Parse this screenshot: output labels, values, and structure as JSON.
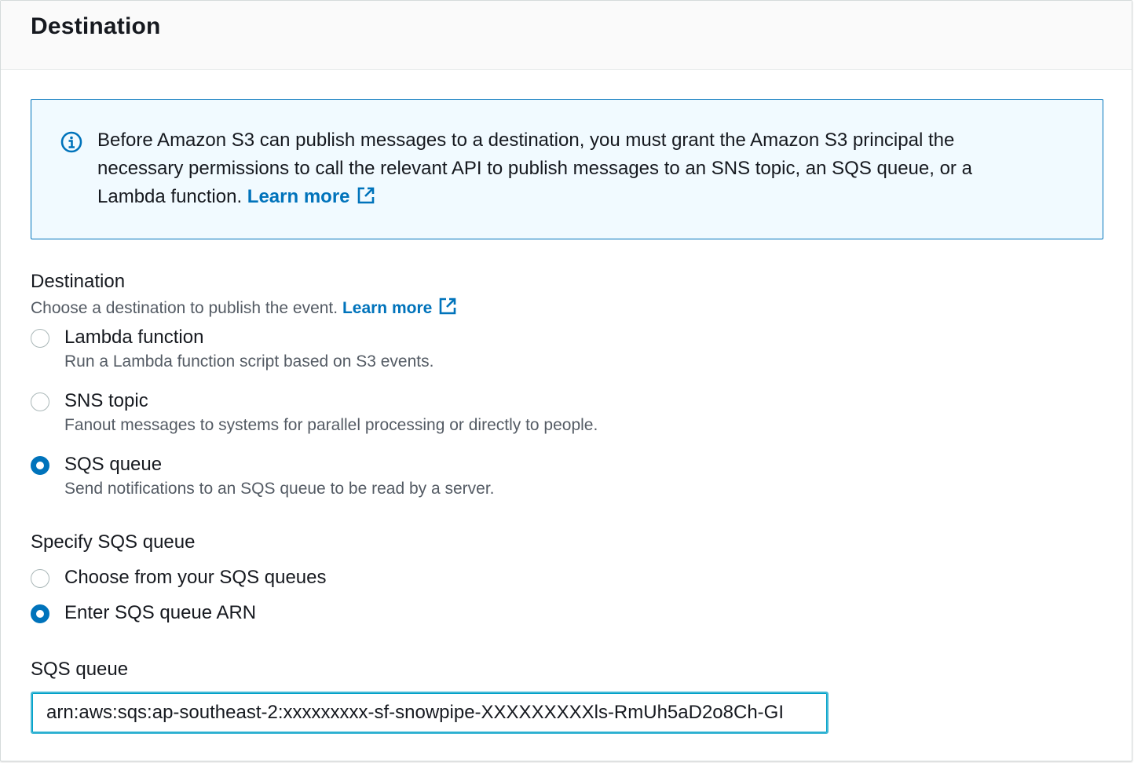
{
  "panel": {
    "title": "Destination"
  },
  "info": {
    "icon": "info-icon",
    "text": "Before Amazon S3 can publish messages to a destination, you must grant the Amazon S3 principal the necessary permissions to call the relevant API to publish messages to an SNS topic, an SQS queue, or a Lambda function.",
    "link": "Learn more",
    "link_icon": "external-link-icon",
    "accent_color": "#0073bb",
    "background_color": "#f1faff"
  },
  "destination": {
    "label": "Destination",
    "description": "Choose a destination to publish the event.",
    "link": "Learn more",
    "options": [
      {
        "label": "Lambda function",
        "description": "Run a Lambda function script based on S3 events.",
        "selected": false
      },
      {
        "label": "SNS topic",
        "description": "Fanout messages to systems for parallel processing or directly to people.",
        "selected": false
      },
      {
        "label": "SQS queue",
        "description": "Send notifications to an SQS queue to be read by a server.",
        "selected": true
      }
    ]
  },
  "specify": {
    "label": "Specify SQS queue",
    "options": [
      {
        "label": "Choose from your SQS queues",
        "selected": false
      },
      {
        "label": "Enter SQS queue ARN",
        "selected": true
      }
    ]
  },
  "sqs_queue": {
    "label": "SQS queue",
    "value": "arn:aws:sqs:ap-southeast-2:xxxxxxxxx-sf-snowpipe-XXXXXXXXXls-RmUh5aD2o8Ch-GI"
  }
}
